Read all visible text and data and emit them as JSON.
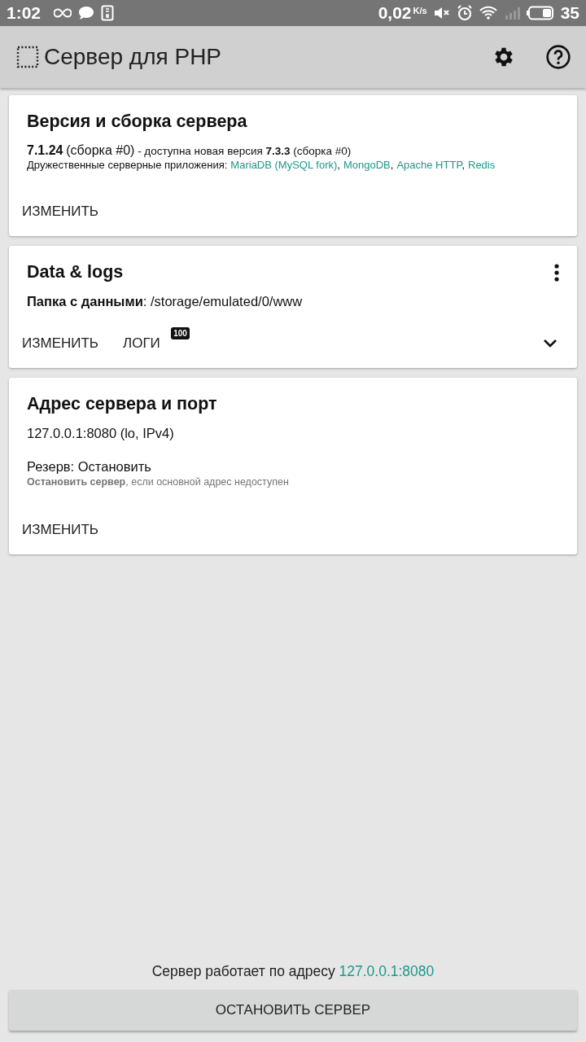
{
  "status_bar": {
    "time": "1:02",
    "speed": "0,02",
    "speed_unit": "K/s",
    "battery": "35"
  },
  "app_bar": {
    "title": "Сервер для PHP"
  },
  "cards": [
    {
      "kind": "version",
      "title": "Версия и сборка сервера",
      "current": "7.1.24",
      "current_build": "(сборка #0)",
      "update": "- доступна новая версия **7.3.3** (сборка #0)",
      "friends_label": "Дружественные серверные приложения:",
      "friends": [
        "MariaDB (MySQL fork)",
        "MongoDB",
        "Apache HTTP",
        "Redis"
      ],
      "separator": ",",
      "actions": [
        {
          "label": "ИЗМЕНИТЬ"
        }
      ]
    },
    {
      "kind": "data",
      "title": "Data & logs",
      "folder": "**Папка с данными**: /storage/emulated/0/www",
      "expanded": false,
      "actions": [
        {
          "label": "ИЗМЕНИТЬ"
        },
        {
          "label": "ЛОГИ",
          "badge": "100"
        }
      ]
    },
    {
      "kind": "address",
      "title": "Адрес сервера и порт",
      "address": "127.0.0.1:8080 (lo, IPv4)",
      "fallback": "Резерв: Остановить",
      "fallback_hint": "**Остановить сервер**, если основной адрес недоступен",
      "actions": [
        {
          "label": "ИЗМЕНИТЬ"
        }
      ]
    }
  ],
  "footer": {
    "status": "Сервер работает по адресу",
    "address": "127.0.0.1:8080",
    "button": "ОСТАНОВИТЬ СЕРВЕР"
  }
}
